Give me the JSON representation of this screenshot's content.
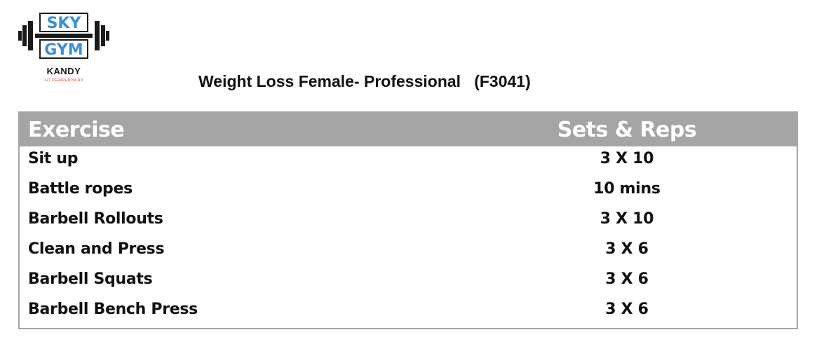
{
  "logo": {
    "line1": "SKY",
    "line2": "GYM",
    "city": "KANDY",
    "address": "421 PERADENIYA RD"
  },
  "title": "Weight Loss Female- Professional   (F3041)",
  "table": {
    "headers": {
      "exercise": "Exercise",
      "sets_reps": "Sets & Reps"
    },
    "rows": [
      {
        "exercise": "Sit up",
        "sets_reps": "3 X 10"
      },
      {
        "exercise": "Battle ropes",
        "sets_reps": "10 mins"
      },
      {
        "exercise": "Barbell Rollouts",
        "sets_reps": "3 X 10"
      },
      {
        "exercise": "Clean and Press",
        "sets_reps": "3 X 6"
      },
      {
        "exercise": "Barbell Squats",
        "sets_reps": "3 X 6"
      },
      {
        "exercise": "Barbell Bench Press",
        "sets_reps": "3 X 6"
      }
    ]
  },
  "colors": {
    "header_bg": "#a5a5a5",
    "header_text": "#ffffff",
    "logo_blue": "#3b8fd6",
    "logo_dark": "#1a1a1a",
    "border": "#a7a7a7"
  }
}
